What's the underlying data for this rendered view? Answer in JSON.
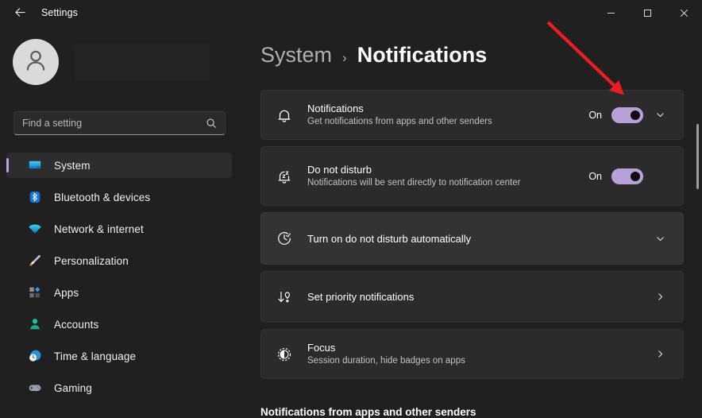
{
  "window": {
    "app_title": "Settings",
    "back_icon": "back-arrow-icon",
    "controls": {
      "minimize": "minimize-icon",
      "maximize": "maximize-icon",
      "close": "close-icon"
    }
  },
  "sidebar": {
    "avatar_icon": "user-avatar-icon",
    "search": {
      "placeholder": "Find a setting",
      "value": "",
      "icon": "search-icon"
    },
    "items": [
      {
        "label": "System",
        "icon": "monitor-icon",
        "selected": true
      },
      {
        "label": "Bluetooth & devices",
        "icon": "bluetooth-icon",
        "selected": false
      },
      {
        "label": "Network & internet",
        "icon": "wifi-icon",
        "selected": false
      },
      {
        "label": "Personalization",
        "icon": "paintbrush-icon",
        "selected": false
      },
      {
        "label": "Apps",
        "icon": "apps-icon",
        "selected": false
      },
      {
        "label": "Accounts",
        "icon": "person-icon",
        "selected": false
      },
      {
        "label": "Time & language",
        "icon": "clock-globe-icon",
        "selected": false
      },
      {
        "label": "Gaming",
        "icon": "gamepad-icon",
        "selected": false
      }
    ]
  },
  "main": {
    "breadcrumb": {
      "parent": "System",
      "separator": "›",
      "current": "Notifications"
    },
    "cards": [
      {
        "title": "Notifications",
        "subtitle": "Get notifications from apps and other senders",
        "icon": "bell-icon",
        "toggle_state": "On",
        "toggle_on": true,
        "trailing": "chevron-down-icon"
      },
      {
        "title": "Do not disturb",
        "subtitle": "Notifications will be sent directly to notification center",
        "icon": "bell-sleep-icon",
        "toggle_state": "On",
        "toggle_on": true,
        "trailing": "none"
      },
      {
        "title": "Turn on do not disturb automatically",
        "subtitle": "",
        "icon": "clock-arrow-icon",
        "toggle_state": "",
        "toggle_on": null,
        "trailing": "chevron-down-icon",
        "hover": true
      },
      {
        "title": "Set priority notifications",
        "subtitle": "",
        "icon": "priority-arrow-icon",
        "toggle_state": "",
        "toggle_on": null,
        "trailing": "chevron-right-icon"
      },
      {
        "title": "Focus",
        "subtitle": "Session duration, hide badges on apps",
        "icon": "focus-icon",
        "toggle_state": "",
        "toggle_on": null,
        "trailing": "chevron-right-icon"
      }
    ],
    "section_heading": "Notifications from apps and other senders"
  },
  "annotation": {
    "type": "arrow",
    "color": "#ee1d1d",
    "points_to": "notifications-toggle"
  },
  "colors": {
    "accent": "#b9a0d9",
    "window_bg": "#202020",
    "card_bg": "#2b2b2b",
    "card_hover_bg": "#333333",
    "annotation_red": "#ee1d1d"
  }
}
